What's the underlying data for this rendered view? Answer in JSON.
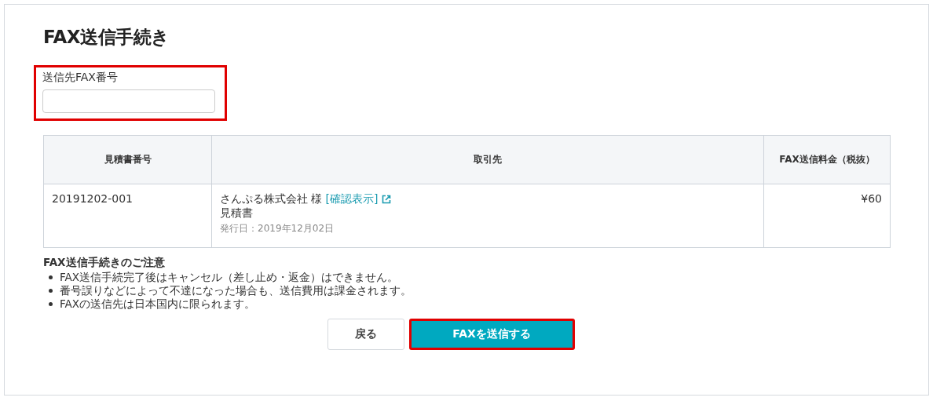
{
  "title": "FAX送信手続き",
  "fax_field": {
    "label": "送信先FAX番号",
    "highlighted": true
  },
  "table": {
    "columns": [
      "見積書番号",
      "取引先",
      "FAX送信料金（税抜）"
    ],
    "rows": [
      {
        "number": "20191202-001",
        "client": "さんぷる株式会社 様",
        "link": "[確認表示]",
        "document": "見積書",
        "issued": "発行日：2019年12月02日",
        "fee": "¥60"
      }
    ]
  },
  "notes": {
    "title": "FAX送信手続きのご注意",
    "items": [
      "FAX送信手続完了後はキャンセル（差し止め・返金）はできません。",
      "番号誤りなどによって不達になった場合も、送信費用は課金されます。",
      "FAXの送信先は日本国内に限られます。"
    ]
  },
  "buttons": [
    {
      "label": "戻る",
      "kind": "secondary",
      "highlighted": false
    },
    {
      "label": "FAXを送信する",
      "kind": "primary",
      "highlighted": true
    }
  ]
}
